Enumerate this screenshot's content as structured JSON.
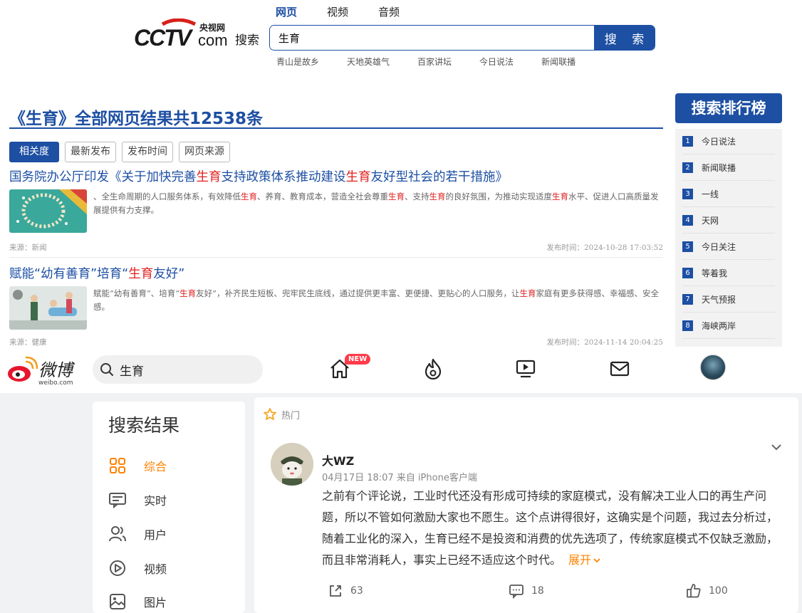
{
  "cctv": {
    "logo_text": "CCTV.com 央视网",
    "logo_suffix": "搜索",
    "tabs": [
      "网页",
      "视频",
      "音频"
    ],
    "search_value": "生育",
    "search_button": "搜 索",
    "hot_links": [
      "青山是故乡",
      "天地英雄气",
      "百家讲坛",
      "今日说法",
      "新闻联播"
    ],
    "results_title": "《生育》全部网页结果共12538条",
    "sort_options": [
      "相关度",
      "最新发布",
      "发布时间",
      "网页来源"
    ],
    "results": [
      {
        "title_parts": [
          "国务院办公厅印发《关于加快完善",
          "生育",
          "支持政策体系推动建设",
          "生育",
          "友好型社会的若干措施》"
        ],
        "summary_parts": [
          "、全生命周期的人口服务体系，有效降低",
          "生",
          "育",
          "、养育、教育成本，营造全社会尊重",
          "生",
          "育",
          "、支持",
          "生",
          "育",
          "的良好氛围，为推动实现适度",
          "生",
          "育",
          "水平、促进人口高质量发展提供有力支撑。"
        ],
        "source": "来源：新闻",
        "time": "发布时间：2024-10-28 17:03:52"
      },
      {
        "title_parts": [
          "赋能“幼有善育”培育“",
          "生育",
          "友好”"
        ],
        "summary_parts": [
          "赋能“幼有善育”、培育“",
          "生",
          "育",
          "友好”，补齐民生短板、兜牢民生底线，通过提供更丰富、更便捷、更贴心的人口服务，让",
          "生",
          "育",
          "家庭有更多获得感、幸福感、安全感。"
        ],
        "source": "来源：健康",
        "time": "发布时间：2024-11-14 20:04:25"
      }
    ],
    "ranking_title": "搜索排行榜",
    "ranking": [
      {
        "num": "1",
        "label": "今日说法"
      },
      {
        "num": "2",
        "label": "新闻联播"
      },
      {
        "num": "3",
        "label": "一线"
      },
      {
        "num": "4",
        "label": "天网"
      },
      {
        "num": "5",
        "label": "今日关注"
      },
      {
        "num": "6",
        "label": "等着我"
      },
      {
        "num": "7",
        "label": "天气预报"
      },
      {
        "num": "8",
        "label": "海峡两岸"
      }
    ]
  },
  "weibo": {
    "logo_text": "微博",
    "logo_sub": "weibo.com",
    "search_value": "生育",
    "new_badge": "NEW",
    "side_title": "搜索结果",
    "side_items": [
      {
        "label": "综合",
        "icon": "grid-icon"
      },
      {
        "label": "实时",
        "icon": "chat-card-icon"
      },
      {
        "label": "用户",
        "icon": "users-icon"
      },
      {
        "label": "视频",
        "icon": "play-circle-icon"
      },
      {
        "label": "图片",
        "icon": "image-icon"
      }
    ],
    "hot_label": "热门",
    "post": {
      "author": "大WZ",
      "meta": "04月17日 18:07  来自 iPhone客户端",
      "text": "之前有个评论说，工业时代还没有形成可持续的家庭模式，没有解决工业人口的再生产问题，所以不管如何激励大家也不愿生。这个点讲得很好，这确实是个问题，我过去分析过，随着工业化的深入，生育已经不是投资和消费的优先选项了，传统家庭模式不仅缺乏激励，而且非常消耗人，事实上已经不适应这个时代。",
      "expand": "展开",
      "reposts": "63",
      "comments": "18",
      "likes": "100"
    }
  },
  "colors": {
    "cctv_blue": "#1d4fa3",
    "highlight_red": "#e02020",
    "weibo_orange": "#ff8200",
    "weibo_red": "#e6162d"
  }
}
